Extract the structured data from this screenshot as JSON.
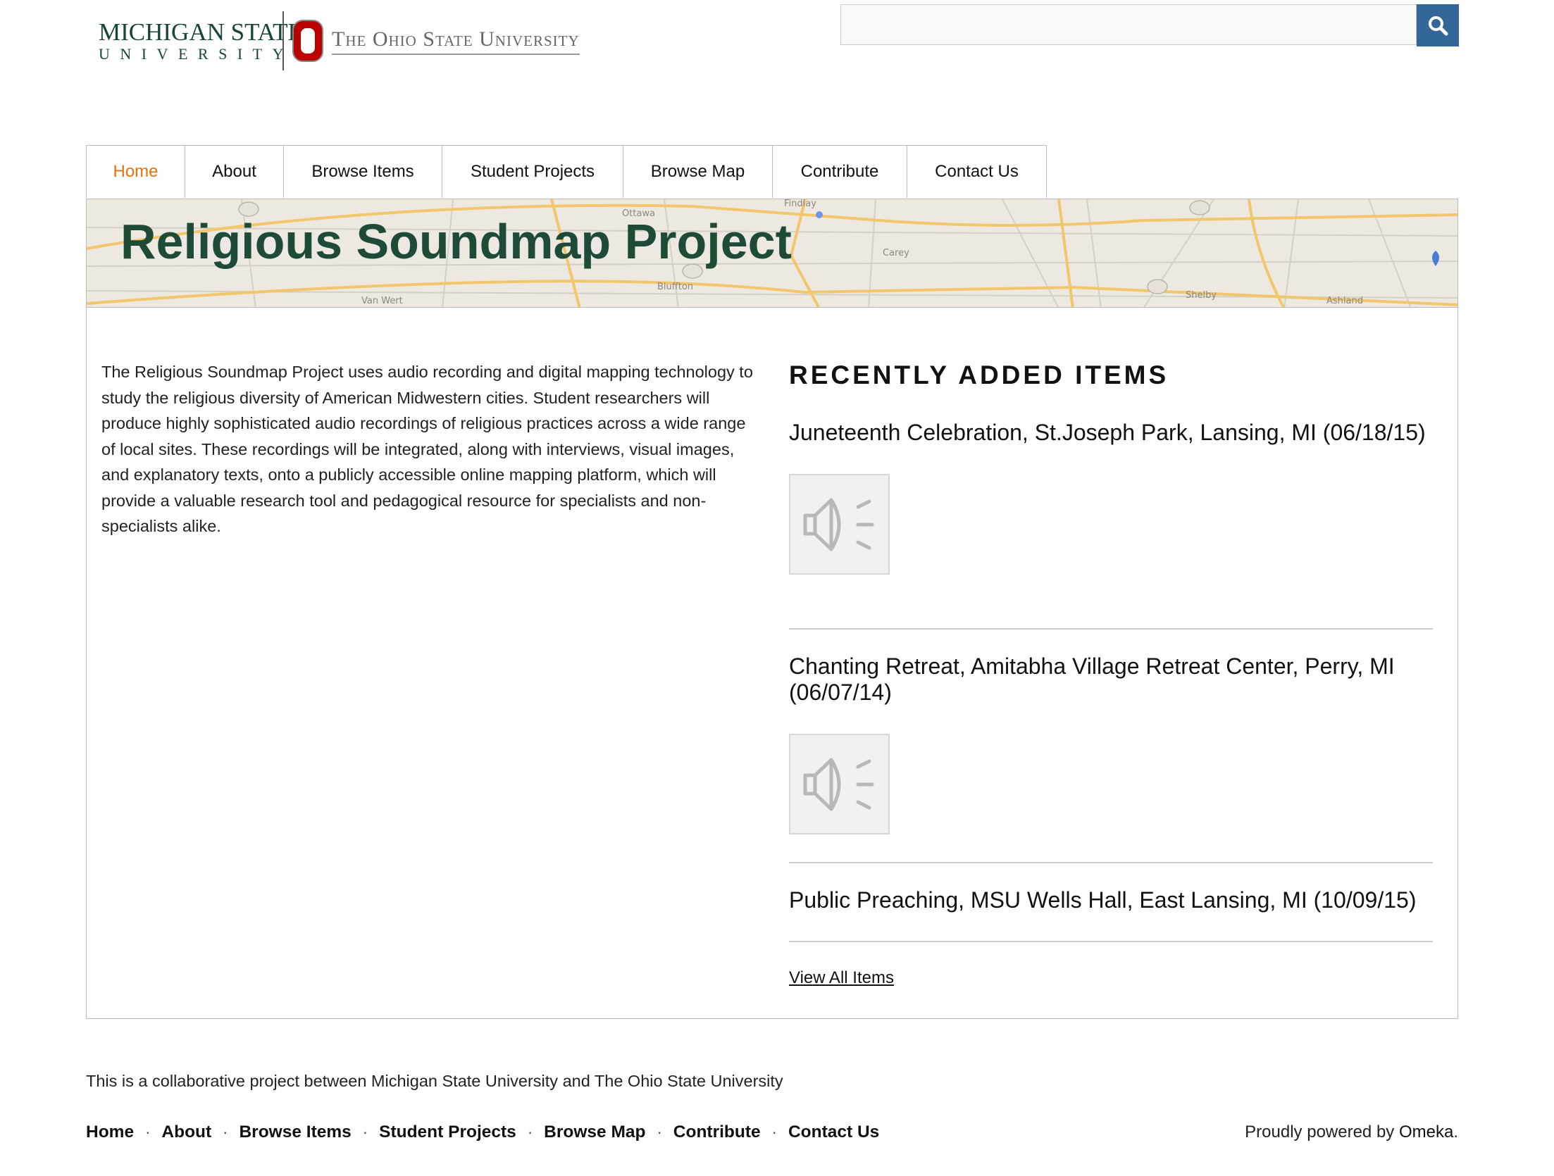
{
  "header": {
    "msu_logo": {
      "line1": "MICHIGAN STATE",
      "line2": "UNIVERSITY"
    },
    "osu_logo": {
      "name": "The Ohio State University"
    },
    "search": {
      "placeholder": "",
      "value": "",
      "button_icon": "search-icon"
    }
  },
  "nav": {
    "items": [
      {
        "label": "Home",
        "active": true
      },
      {
        "label": "About"
      },
      {
        "label": "Browse Items"
      },
      {
        "label": "Student Projects"
      },
      {
        "label": "Browse Map"
      },
      {
        "label": "Contribute"
      },
      {
        "label": "Contact Us"
      }
    ]
  },
  "banner": {
    "title": "Religious Soundmap Project",
    "map_labels": [
      "Ottawa",
      "Van Wert",
      "Bluffton",
      "Carey",
      "Shelby",
      "Ashland",
      "Findlay"
    ]
  },
  "main": {
    "intro": "The Religious Soundmap Project uses audio recording and digital mapping technology to study the religious diversity of American Midwestern cities. Student researchers will produce highly sophisticated audio recordings of religious practices across a wide range of local sites. These recordings will be integrated, along with interviews, visual images, and explanatory texts, onto a publicly accessible online mapping platform, which will provide a valuable research tool and pedagogical resource for specialists and non-specialists alike.",
    "recent": {
      "heading": "RECENTLY ADDED ITEMS",
      "items": [
        {
          "title": "Juneteenth Celebration, St.Joseph Park, Lansing, MI (06/18/15)",
          "thumbnail_icon": "audio-speaker-icon"
        },
        {
          "title": "Chanting Retreat, Amitabha Village Retreat Center, Perry, MI (06/07/14)",
          "thumbnail_icon": "audio-speaker-icon"
        },
        {
          "title": "Public Preaching, MSU Wells Hall, East Lansing, MI (10/09/15)"
        }
      ],
      "view_all": "View All Items"
    }
  },
  "footer": {
    "text": "This is a collaborative project between Michigan State University and The Ohio State University",
    "links": [
      "Home",
      "About",
      "Browse Items",
      "Student Projects",
      "Browse Map",
      "Contribute",
      "Contact Us"
    ],
    "separator": "·",
    "powered_prefix": "Proudly powered by ",
    "powered_link": "Omeka",
    "powered_suffix": "."
  },
  "colors": {
    "accent_active": "#e8720c",
    "search_button": "#336699",
    "msu_green": "#18453B",
    "osu_red": "#bb0000",
    "banner_title": "#1e4a38"
  }
}
